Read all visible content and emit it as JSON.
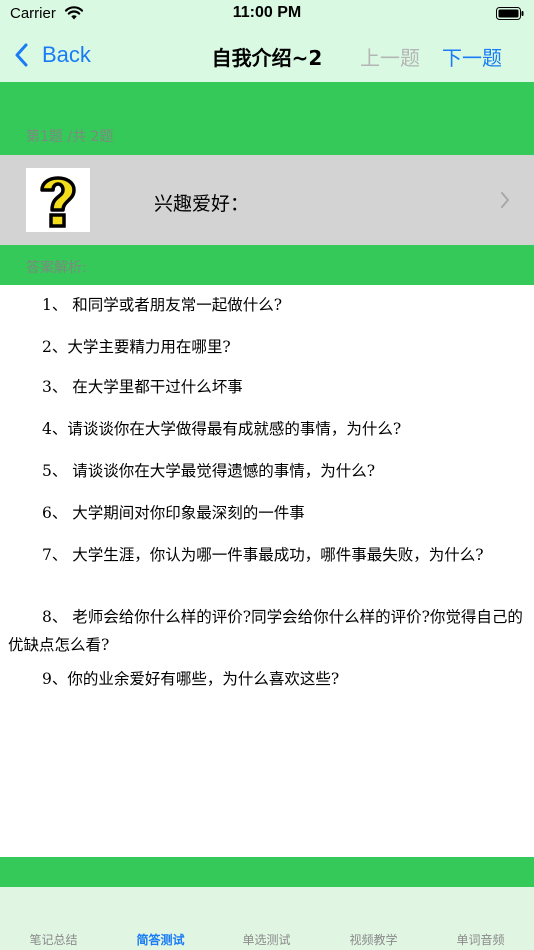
{
  "status_bar": {
    "carrier": "Carrier",
    "time": "11:00 PM",
    "wifi_icon": "wifi-icon",
    "battery_icon": "battery-icon"
  },
  "nav": {
    "back_label": "Back",
    "title": "自我介绍~2",
    "prev_label": "上一题",
    "next_label": "下一题"
  },
  "question": {
    "counter": "第1题 /共 2题",
    "title": "兴趣爱好：",
    "image_icon": "question-mark-icon"
  },
  "answer": {
    "label": "答案解析:",
    "items": [
      "1、 和同学或者朋友常一起做什么?",
      "2、大学主要精力用在哪里?",
      "3、 在大学里都干过什么坏事",
      "4、请谈谈你在大学做得最有成就感的事情，为什么?",
      "5、 请谈谈你在大学最觉得遗憾的事情，为什么?",
      "6、 大学期间对你印象最深刻的一件事",
      "7、 大学生涯，你认为哪一件事最成功，哪件事最失败，为什么?",
      "8、 老师会给你什么样的评价?同学会给你什么样的评价?你觉得自己的优缺点怎么看?",
      "9、你的业余爱好有哪些，为什么喜欢这些?"
    ]
  },
  "tabs": [
    {
      "label": "笔记总结",
      "active": false
    },
    {
      "label": "简答测试",
      "active": true
    },
    {
      "label": "单选测试",
      "active": false
    },
    {
      "label": "视频教学",
      "active": false
    },
    {
      "label": "单词音频",
      "active": false
    }
  ],
  "colors": {
    "accent": "#1a7cf5",
    "green": "#35c95a",
    "nav_background": "#d9f9e3",
    "disabled": "#b5b5b5"
  }
}
